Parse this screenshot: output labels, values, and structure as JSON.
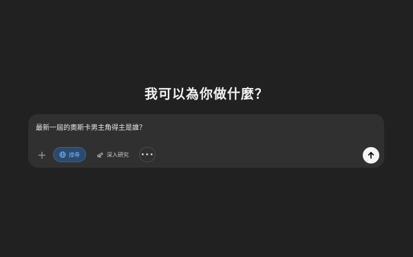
{
  "main": {
    "heading": "我可以為你做什麼？"
  },
  "composer": {
    "prompt_text": "最新一屆的奧斯卡男主角得主是誰？",
    "plus_symbol": "+",
    "search_label": "搜尋",
    "deep_research_label": "深入研究",
    "more_symbol": "•••"
  },
  "icons": {
    "plus": "plus-icon",
    "search": "globe-icon",
    "deep_research": "telescope-icon",
    "more": "ellipsis-icon",
    "send": "arrow-up-icon"
  },
  "colors": {
    "background": "#212121",
    "composer": "#303030",
    "search_accent": "#7cb6ff",
    "send_button": "#f5f5f5"
  }
}
